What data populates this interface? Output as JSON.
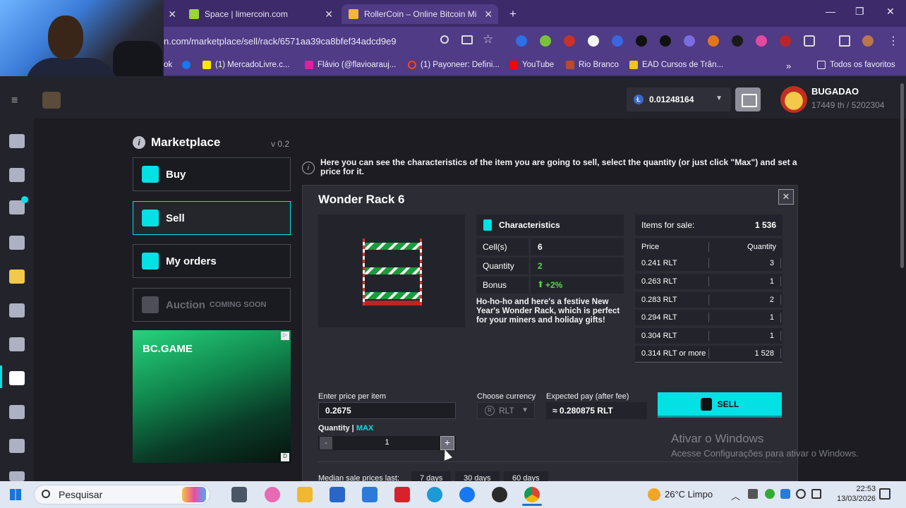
{
  "browser": {
    "tabs": [
      {
        "title": "Space | limercoin.com",
        "active": false
      },
      {
        "title": "RollerCoin – Online Bitcoin Mi…",
        "active": true
      }
    ],
    "new_tab": "+",
    "close_glyph": "✕",
    "url": "n.com/marketplace/sell/rack/6571aa39ca8bfef34adcd9e9",
    "window_controls": [
      "—",
      "❐",
      "✕"
    ],
    "bookmarks": [
      {
        "label": "ok",
        "icon": "generic"
      },
      {
        "label": "",
        "icon": "facebook-icon"
      },
      {
        "label": "(1) MercadoLivre.c...",
        "icon": "mercadolivre-icon"
      },
      {
        "label": "Flávio (@flavioarauj...",
        "icon": "instagram-icon"
      },
      {
        "label": "(1) Payoneer: Defini...",
        "icon": "payoneer-icon"
      },
      {
        "label": "YouTube",
        "icon": "youtube-icon"
      },
      {
        "label": "Rio Branco",
        "icon": "car-icon"
      },
      {
        "label": "EAD Cursos de Trân...",
        "icon": "ead-icon"
      }
    ],
    "bookmarks_more": "»",
    "all_bookmarks": "Todos os favoritos"
  },
  "header": {
    "balance": "0.01248164",
    "balance_currency_icon": "Ł",
    "username": "BUGADAO",
    "user_stats": "17449 th / 5202304"
  },
  "marketplace": {
    "title": "Marketplace",
    "version": "v 0.2",
    "nav": [
      {
        "label": "Buy",
        "active": false
      },
      {
        "label": "Sell",
        "active": true
      },
      {
        "label": "My orders",
        "active": false
      },
      {
        "label": "Auction",
        "badge": "COMING SOON",
        "disabled": true
      }
    ],
    "ad": {
      "logo": "BC.GAME",
      "corner": "▷",
      "corner2": "D"
    }
  },
  "hint": "Here you can see the characteristics of the item you are going to sell, select the quantity (or just click \"Max\") and set a price for it.",
  "item": {
    "name": "Wonder Rack 6",
    "characteristics_title": "Characteristics",
    "rows": [
      {
        "key": "Cell(s)",
        "value": "6",
        "color": "#ffffff"
      },
      {
        "key": "Quantity",
        "value": "2",
        "color": "#4fdc3c"
      },
      {
        "key": "Bonus",
        "value": "+2%",
        "color": "#4fdc3c"
      }
    ],
    "description": "Ho-ho-ho and here's a festive New Year's Wonder Rack, which is perfect for your miners and holiday gifts!"
  },
  "sales": {
    "items_for_sale_label": "Items for sale:",
    "items_for_sale_value": "1 536",
    "col_price": "Price",
    "col_quantity": "Quantity",
    "rows": [
      {
        "price": "0.241 RLT",
        "qty": "3"
      },
      {
        "price": "0.263 RLT",
        "qty": "1"
      },
      {
        "price": "0.283 RLT",
        "qty": "2"
      },
      {
        "price": "0.294 RLT",
        "qty": "1"
      },
      {
        "price": "0.304 RLT",
        "qty": "1"
      },
      {
        "price": "0.314 RLT or more",
        "qty": "1 528"
      }
    ]
  },
  "form": {
    "price_label": "Enter price per item",
    "price_value": "0.2675",
    "currency_label": "Choose currency",
    "currency_value": "RLT",
    "expected_label": "Expected pay (after fee)",
    "expected_value": "≈ 0.280875 RLT",
    "sell_label": "SELL",
    "quantity_label": "Quantity |",
    "max_label": "MAX",
    "quantity_value": "1",
    "minus": "-",
    "plus": "+",
    "median_label": "Median sale prices last:",
    "ranges": [
      "7 days",
      "30 days",
      "60 days"
    ]
  },
  "watermark": {
    "line1": "Ativar o Windows",
    "line2": "Acesse Configurações para ativar o Windows."
  },
  "taskbar": {
    "search_placeholder": "Pesquisar",
    "weather": "26°C  Limpo",
    "time": "22:53",
    "date": "13/03/2026"
  }
}
